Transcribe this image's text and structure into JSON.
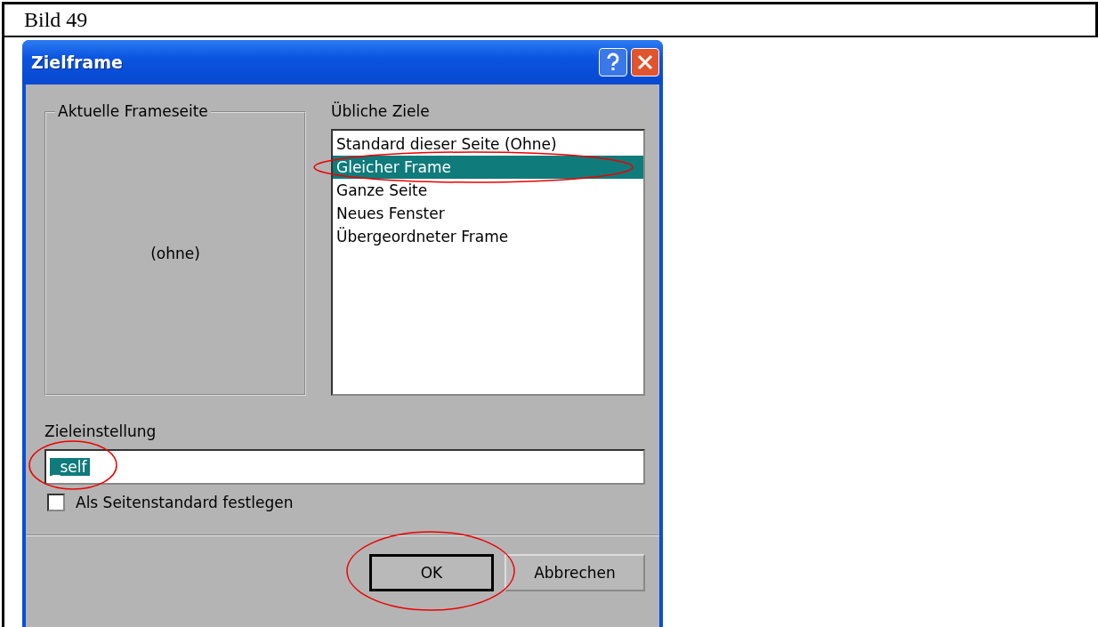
{
  "caption": "Bild 49",
  "dialog": {
    "title": "Zielframe",
    "frame_group": {
      "legend": "Aktuelle Frameseite",
      "value": "(ohne)"
    },
    "targets": {
      "label": "Übliche Ziele",
      "items": [
        {
          "label": "Standard dieser Seite (Ohne)",
          "selected": false,
          "circled": false
        },
        {
          "label": "Gleicher Frame",
          "selected": true,
          "circled": true
        },
        {
          "label": "Ganze Seite",
          "selected": false,
          "circled": false
        },
        {
          "label": "Neues Fenster",
          "selected": false,
          "circled": false
        },
        {
          "label": "Übergeordneter Frame",
          "selected": false,
          "circled": false
        }
      ]
    },
    "target_setting": {
      "label": "Zieleinstellung",
      "value": "_self",
      "circled": true
    },
    "default_checkbox": {
      "label": "Als Seitenstandard festlegen",
      "checked": false
    },
    "buttons": [
      {
        "label": "OK",
        "default": true,
        "circled": true
      },
      {
        "label": "Abbrechen",
        "default": false,
        "circled": false
      }
    ]
  }
}
